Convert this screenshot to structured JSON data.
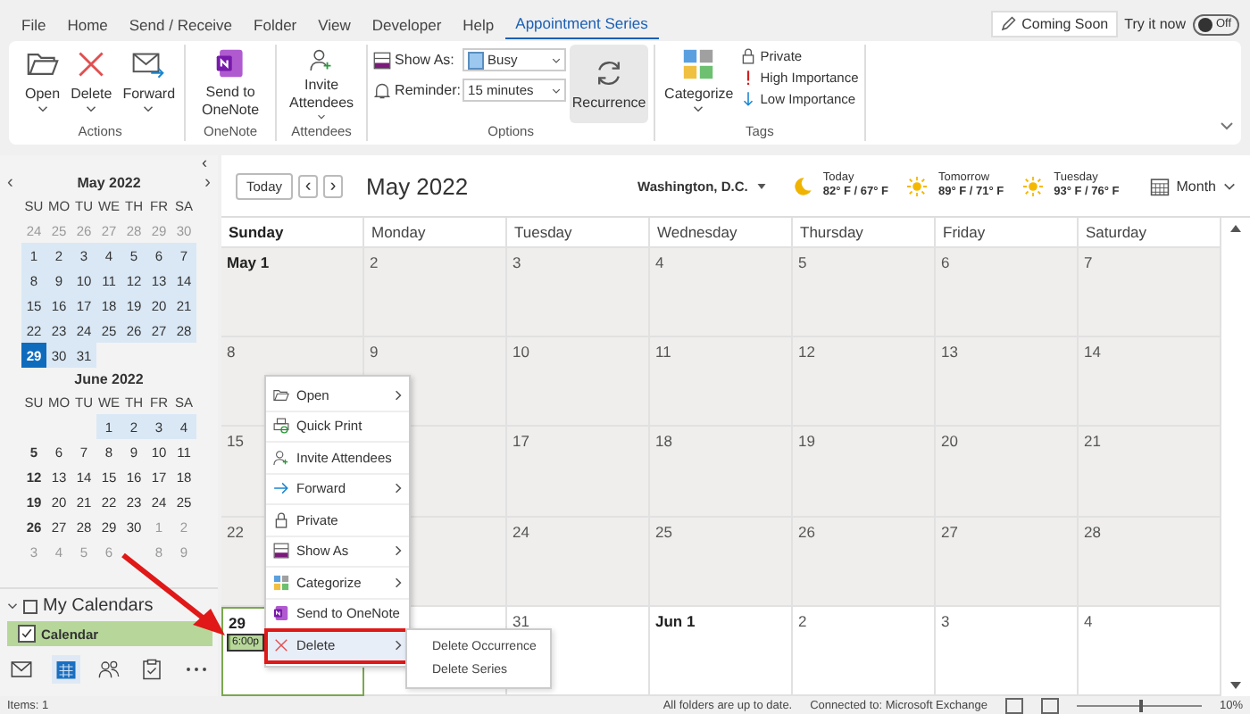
{
  "menu_tabs": [
    {
      "label": "File",
      "selected": false
    },
    {
      "label": "Home",
      "selected": false
    },
    {
      "label": "Send / Receive",
      "selected": false
    },
    {
      "label": "Folder",
      "selected": false
    },
    {
      "label": "View",
      "selected": false
    },
    {
      "label": "Developer",
      "selected": false
    },
    {
      "label": "Help",
      "selected": false
    },
    {
      "label": "Appointment Series",
      "selected": true
    }
  ],
  "coming_soon": {
    "label": "Coming Soon",
    "try_label": "Try it now",
    "toggle": "Off",
    "on": false
  },
  "ribbon": {
    "groups": [
      {
        "label": "Actions",
        "buttons": [
          {
            "label": "Open",
            "dropdown": true,
            "selected": false
          },
          {
            "label": "Delete",
            "dropdown": true,
            "selected": false
          },
          {
            "label": "Forward",
            "dropdown": true,
            "selected": false
          }
        ]
      },
      {
        "label": "OneNote",
        "buttons": [
          {
            "label": "Send to OneNote",
            "dropdown": false,
            "selected": false
          }
        ]
      },
      {
        "label": "Attendees",
        "buttons": [
          {
            "label": "Invite Attendees",
            "dropdown": true,
            "selected": false
          }
        ]
      },
      {
        "label": "Options",
        "fields": [
          {
            "label": "Show As:",
            "value": "Busy"
          },
          {
            "label": "Reminder:",
            "value": "15 minutes"
          }
        ],
        "buttons": [
          {
            "label": "Recurrence",
            "dropdown": false,
            "selected": true
          }
        ]
      },
      {
        "label": "Tags",
        "buttons": [
          {
            "label": "Categorize",
            "dropdown": true,
            "selected": false
          }
        ],
        "small": [
          "Private",
          "High Importance",
          "Low Importance"
        ]
      }
    ]
  },
  "sidebar": {
    "collapse": "‹",
    "mini_calendars": [
      {
        "title": "May 2022",
        "prev": "‹",
        "next": "›",
        "weekdays": [
          "SU",
          "MO",
          "TU",
          "WE",
          "TH",
          "FR",
          "SA"
        ],
        "weeks": [
          [
            {
              "d": "24",
              "kind": "other"
            },
            {
              "d": "25",
              "kind": "other"
            },
            {
              "d": "26",
              "kind": "other"
            },
            {
              "d": "27",
              "kind": "other"
            },
            {
              "d": "28",
              "kind": "other"
            },
            {
              "d": "29",
              "kind": "other"
            },
            {
              "d": "30",
              "kind": "other"
            }
          ],
          [
            {
              "d": "1",
              "kind": "range"
            },
            {
              "d": "2",
              "kind": "range"
            },
            {
              "d": "3",
              "kind": "range"
            },
            {
              "d": "4",
              "kind": "range"
            },
            {
              "d": "5",
              "kind": "range"
            },
            {
              "d": "6",
              "kind": "range"
            },
            {
              "d": "7",
              "kind": "range"
            }
          ],
          [
            {
              "d": "8",
              "kind": "range"
            },
            {
              "d": "9",
              "kind": "range"
            },
            {
              "d": "10",
              "kind": "range"
            },
            {
              "d": "11",
              "kind": "range"
            },
            {
              "d": "12",
              "kind": "range"
            },
            {
              "d": "13",
              "kind": "range"
            },
            {
              "d": "14",
              "kind": "range"
            }
          ],
          [
            {
              "d": "15",
              "kind": "range"
            },
            {
              "d": "16",
              "kind": "range"
            },
            {
              "d": "17",
              "kind": "range"
            },
            {
              "d": "18",
              "kind": "range"
            },
            {
              "d": "19",
              "kind": "range"
            },
            {
              "d": "20",
              "kind": "range"
            },
            {
              "d": "21",
              "kind": "range"
            }
          ],
          [
            {
              "d": "22",
              "kind": "range"
            },
            {
              "d": "23",
              "kind": "range"
            },
            {
              "d": "24",
              "kind": "range"
            },
            {
              "d": "25",
              "kind": "range"
            },
            {
              "d": "26",
              "kind": "range"
            },
            {
              "d": "27",
              "kind": "range"
            },
            {
              "d": "28",
              "kind": "range"
            }
          ],
          [
            {
              "d": "29",
              "kind": "selected"
            },
            {
              "d": "30",
              "kind": "range"
            },
            {
              "d": "31",
              "kind": "range"
            }
          ]
        ]
      },
      {
        "title": "June 2022",
        "weekdays": [
          "SU",
          "MO",
          "TU",
          "WE",
          "TH",
          "FR",
          "SA"
        ],
        "weeks": [
          [
            {
              "kind": "blank"
            },
            {
              "kind": "blank"
            },
            {
              "kind": "blank"
            },
            {
              "d": "1",
              "kind": "range"
            },
            {
              "d": "2",
              "kind": "range"
            },
            {
              "d": "3",
              "kind": "range"
            },
            {
              "d": "4",
              "kind": "range"
            }
          ],
          [
            {
              "d": "5",
              "kind": "bold"
            },
            {
              "d": "6",
              "kind": "plain"
            },
            {
              "d": "7",
              "kind": "plain"
            },
            {
              "d": "8",
              "kind": "plain"
            },
            {
              "d": "9",
              "kind": "plain"
            },
            {
              "d": "10",
              "kind": "plain"
            },
            {
              "d": "11",
              "kind": "plain"
            }
          ],
          [
            {
              "d": "12",
              "kind": "bold"
            },
            {
              "d": "13",
              "kind": "plain"
            },
            {
              "d": "14",
              "kind": "plain"
            },
            {
              "d": "15",
              "kind": "plain"
            },
            {
              "d": "16",
              "kind": "plain"
            },
            {
              "d": "17",
              "kind": "plain"
            },
            {
              "d": "18",
              "kind": "plain"
            }
          ],
          [
            {
              "d": "19",
              "kind": "bold"
            },
            {
              "d": "20",
              "kind": "plain"
            },
            {
              "d": "21",
              "kind": "plain"
            },
            {
              "d": "22",
              "kind": "plain"
            },
            {
              "d": "23",
              "kind": "plain"
            },
            {
              "d": "24",
              "kind": "plain"
            },
            {
              "d": "25",
              "kind": "plain"
            }
          ],
          [
            {
              "d": "26",
              "kind": "bold"
            },
            {
              "d": "27",
              "kind": "plain"
            },
            {
              "d": "28",
              "kind": "plain"
            },
            {
              "d": "29",
              "kind": "plain"
            },
            {
              "d": "30",
              "kind": "plain"
            },
            {
              "d": "1",
              "kind": "other"
            },
            {
              "d": "2",
              "kind": "other"
            }
          ],
          [
            {
              "d": "3",
              "kind": "other"
            },
            {
              "d": "4",
              "kind": "other"
            },
            {
              "d": "5",
              "kind": "other"
            },
            {
              "d": "6",
              "kind": "other"
            },
            {
              "kind": "blank"
            },
            {
              "d": "8",
              "kind": "other"
            },
            {
              "d": "9",
              "kind": "other"
            }
          ]
        ]
      }
    ],
    "folders": {
      "label": "My Calendars",
      "expanded": true,
      "items": [
        {
          "label": "Calendar",
          "checked": true,
          "selected": true
        }
      ]
    },
    "nav": [
      {
        "selected": false
      },
      {
        "selected": true
      },
      {
        "selected": false
      },
      {
        "selected": false
      },
      {
        "selected": false
      }
    ]
  },
  "calendar": {
    "today_button": "Today",
    "prev": "‹",
    "next": "›",
    "title": "May 2022",
    "location": "Washington, D.C.",
    "weather": [
      {
        "day": "Today",
        "temps": "82° F / 67° F",
        "kind": "night"
      },
      {
        "day": "Tomorrow",
        "temps": "89° F / 71° F",
        "kind": "day"
      },
      {
        "day": "Tuesday",
        "temps": "93° F / 76° F",
        "kind": "day"
      }
    ],
    "view": "Month",
    "columns": [
      {
        "label": "Sunday",
        "bold": true
      },
      {
        "label": "Monday",
        "bold": false
      },
      {
        "label": "Tuesday",
        "bold": false
      },
      {
        "label": "Wednesday",
        "bold": false
      },
      {
        "label": "Thursday",
        "bold": false
      },
      {
        "label": "Friday",
        "bold": false
      },
      {
        "label": "Saturday",
        "bold": false
      }
    ],
    "weeks": [
      [
        {
          "day": "May 1",
          "bold": true,
          "past": true
        },
        {
          "day": "2",
          "bold": false,
          "past": true
        },
        {
          "day": "3",
          "bold": false,
          "past": true
        },
        {
          "day": "4",
          "bold": false,
          "past": true
        },
        {
          "day": "5",
          "bold": false,
          "past": true
        },
        {
          "day": "6",
          "bold": false,
          "past": true
        },
        {
          "day": "7",
          "bold": false,
          "past": true
        }
      ],
      [
        {
          "day": "8",
          "bold": false,
          "past": true
        },
        {
          "day": "9",
          "bold": false,
          "past": true
        },
        {
          "day": "10",
          "bold": false,
          "past": true
        },
        {
          "day": "11",
          "bold": false,
          "past": true
        },
        {
          "day": "12",
          "bold": false,
          "past": true
        },
        {
          "day": "13",
          "bold": false,
          "past": true
        },
        {
          "day": "14",
          "bold": false,
          "past": true
        }
      ],
      [
        {
          "day": "15",
          "bold": false,
          "past": true
        },
        {
          "past": true
        },
        {
          "day": "17",
          "bold": false,
          "past": true
        },
        {
          "day": "18",
          "bold": false,
          "past": true
        },
        {
          "day": "19",
          "bold": false,
          "past": true
        },
        {
          "day": "20",
          "bold": false,
          "past": true
        },
        {
          "day": "21",
          "bold": false,
          "past": true
        }
      ],
      [
        {
          "day": "22",
          "bold": false,
          "past": true
        },
        {
          "past": true
        },
        {
          "day": "24",
          "bold": false,
          "past": true
        },
        {
          "day": "25",
          "bold": false,
          "past": true
        },
        {
          "day": "26",
          "bold": false,
          "past": true
        },
        {
          "day": "27",
          "bold": false,
          "past": true
        },
        {
          "day": "28",
          "bold": false,
          "past": true
        }
      ],
      [
        {
          "day": "29",
          "bold": true,
          "past": false,
          "today": true,
          "events": [
            {
              "time": "6:00p",
              "selected": true
            }
          ]
        },
        {
          "past": false
        },
        {
          "day": "31",
          "bold": false,
          "past": false
        },
        {
          "day": "Jun 1",
          "bold": true,
          "past": false
        },
        {
          "day": "2",
          "bold": false,
          "past": false
        },
        {
          "day": "3",
          "bold": false,
          "past": false
        },
        {
          "day": "4",
          "bold": false,
          "past": false
        }
      ]
    ]
  },
  "context_menu": {
    "items": [
      {
        "label": "Open",
        "submenu": true,
        "selected": false
      },
      {
        "label": "Quick Print",
        "submenu": false,
        "selected": false
      },
      {
        "label": "Invite Attendees",
        "submenu": false,
        "selected": false
      },
      {
        "label": "Forward",
        "submenu": true,
        "selected": false
      },
      {
        "label": "Private",
        "submenu": false,
        "selected": false
      },
      {
        "label": "Show As",
        "submenu": true,
        "selected": false
      },
      {
        "label": "Categorize",
        "submenu": true,
        "selected": false
      },
      {
        "label": "Send to OneNote",
        "submenu": false,
        "selected": false
      },
      {
        "label": "Delete",
        "submenu": true,
        "selected": true
      }
    ],
    "submenu": [
      "Delete Occurrence",
      "Delete Series"
    ]
  },
  "status_bar": {
    "items": "Items: 1",
    "sync": "All folders are up to date.",
    "connection": "Connected to: Microsoft Exchange",
    "zoom": "10%",
    "level": 0.5
  }
}
